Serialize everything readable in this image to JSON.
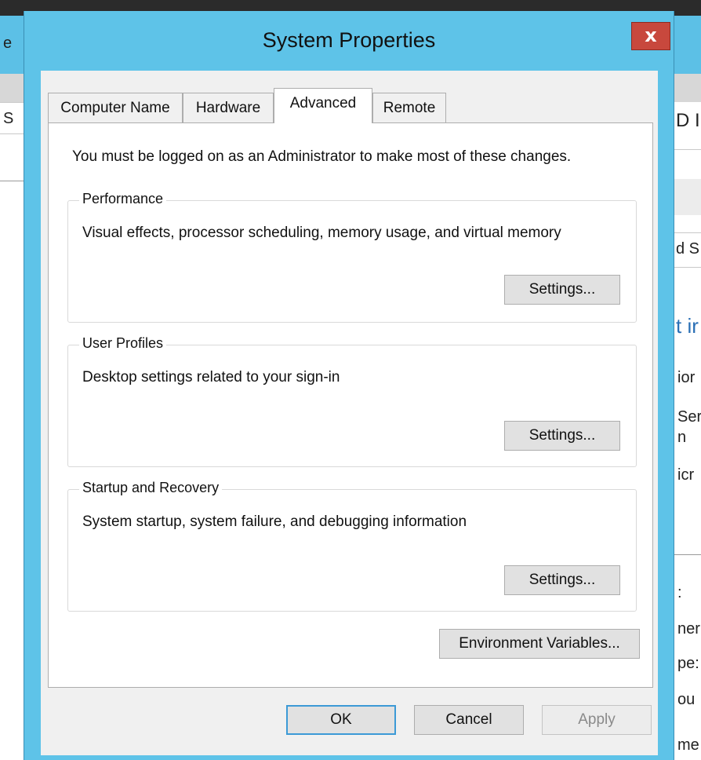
{
  "background": {
    "left_fragments": [
      "e",
      "S"
    ],
    "right_fragments": [
      "D I",
      "d S",
      "t ir",
      "ior",
      "Ser",
      "n",
      "icr",
      ":",
      "ner",
      "pe:",
      "ou",
      "me"
    ]
  },
  "dialog": {
    "title": "System Properties",
    "close_label": "x",
    "tabs": [
      {
        "label": "Computer Name"
      },
      {
        "label": "Hardware"
      },
      {
        "label": "Advanced"
      },
      {
        "label": "Remote"
      }
    ],
    "active_tab": "Advanced",
    "intro": "You must be logged on as an Administrator to make most of these changes.",
    "groups": [
      {
        "title": "Performance",
        "description": "Visual effects, processor scheduling, memory usage, and virtual memory",
        "button": "Settings..."
      },
      {
        "title": "User Profiles",
        "description": "Desktop settings related to your sign-in",
        "button": "Settings..."
      },
      {
        "title": "Startup and Recovery",
        "description": "System startup, system failure, and debugging information",
        "button": "Settings..."
      }
    ],
    "env_button": "Environment Variables...",
    "ok_label": "OK",
    "cancel_label": "Cancel",
    "apply_label": "Apply"
  },
  "colors": {
    "frame": "#5ec3e8",
    "close": "#c8483d",
    "default_button_border": "#3c9ad6"
  }
}
